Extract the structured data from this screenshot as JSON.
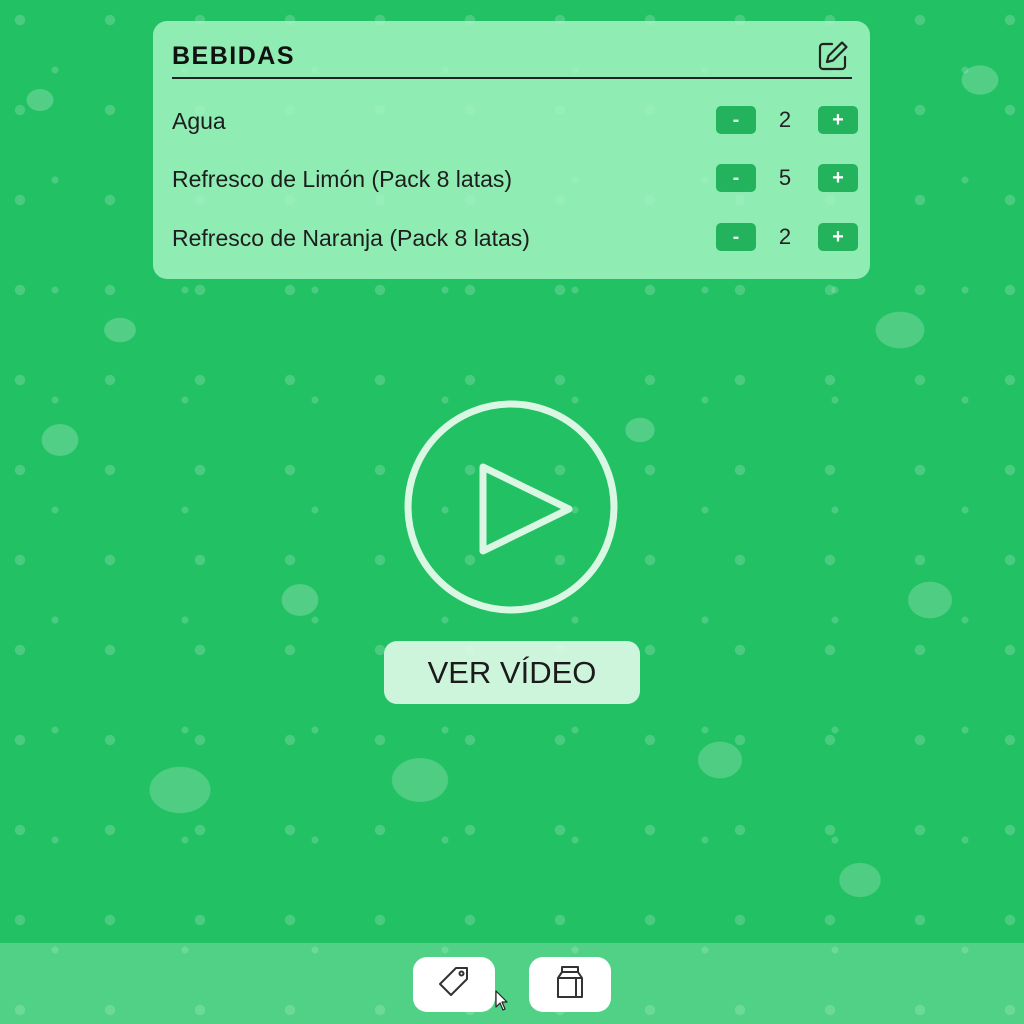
{
  "category": {
    "title": "BEBIDAS",
    "edit_icon": "edit-icon"
  },
  "items": [
    {
      "name": "Agua",
      "quantity": "2",
      "minus_label": "-",
      "plus_label": "+"
    },
    {
      "name": "Refresco de Limón (Pack 8 latas)",
      "quantity": "5",
      "minus_label": "-",
      "plus_label": "+"
    },
    {
      "name": "Refresco de Naranja (Pack 8 latas)",
      "quantity": "2",
      "minus_label": "-",
      "plus_label": "+"
    }
  ],
  "video": {
    "button_label": "VER VÍDEO",
    "play_icon": "play-icon"
  },
  "bottom_nav": [
    {
      "icon": "tag-icon"
    },
    {
      "icon": "milk-carton-icon"
    }
  ],
  "colors": {
    "background": "#22c164",
    "card": "#a7f5c4",
    "quantity_button": "#22b35c"
  }
}
